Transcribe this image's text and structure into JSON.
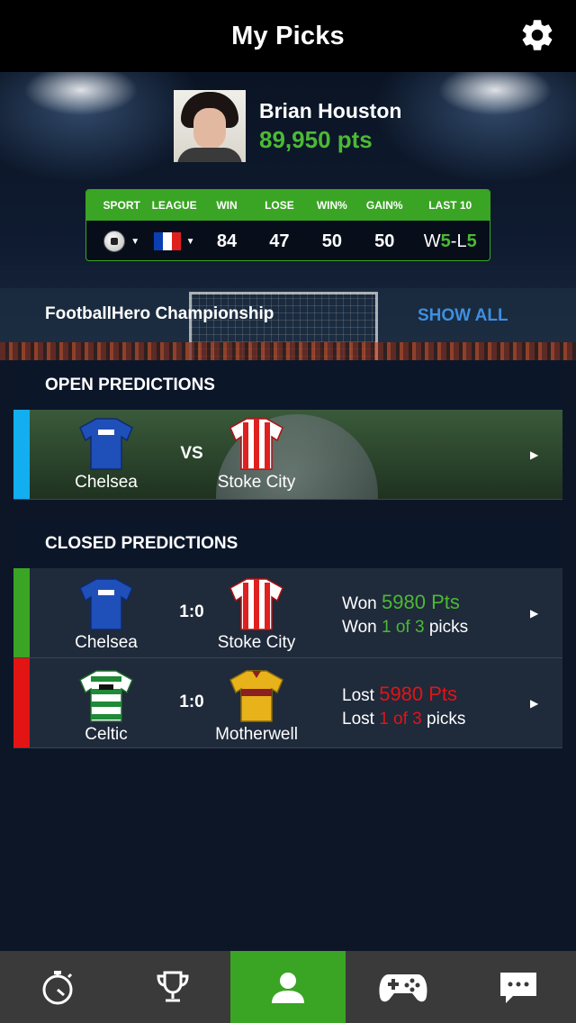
{
  "header": {
    "title": "My Picks",
    "settings_icon": "gear-icon"
  },
  "profile": {
    "name": "Brian Houston",
    "points": "89,950 pts"
  },
  "stats": {
    "headers": [
      "SPORT",
      "LEAGUE",
      "WIN",
      "LOSE",
      "WIN%",
      "GAIN%",
      "LAST 10"
    ],
    "win": "84",
    "lose": "47",
    "win_pct": "50",
    "gain_pct": "50",
    "last10": {
      "w_prefix": "W",
      "w": "5",
      "sep": "-L",
      "l": "5"
    },
    "sport_icon": "soccer-ball-icon",
    "league_icon": "france-flag-icon"
  },
  "championship": {
    "name": "FootballHero Championship",
    "show_all": "SHOW ALL"
  },
  "open_predictions": {
    "title": "OPEN PREDICTIONS",
    "items": [
      {
        "home": "Chelsea",
        "away": "Stoke City",
        "middle": "VS",
        "accent": "#13aef0"
      }
    ]
  },
  "closed_predictions": {
    "title": "CLOSED PREDICTIONS",
    "items": [
      {
        "home": "Chelsea",
        "away": "Stoke City",
        "score": "1:0",
        "accent": "#3aa524",
        "line1_prefix": "Won ",
        "line1_value": "5980 Pts",
        "line2_prefix": "Won ",
        "line2_value": "1 of 3",
        "line2_suffix": " picks",
        "status_color": "#4cb935"
      },
      {
        "home": "Celtic",
        "away": "Motherwell",
        "score": "1:0",
        "accent": "#e31414",
        "line1_prefix": "Lost ",
        "line1_value": "5980 Pts",
        "line2_prefix": "Lost ",
        "line2_value": "1 of 3",
        "line2_suffix": " picks",
        "status_color": "#e31414"
      }
    ]
  },
  "tabbar": {
    "active": "profile",
    "items": [
      "stopwatch-icon",
      "trophy-icon",
      "profile-icon",
      "gamepad-icon",
      "chat-icon"
    ]
  },
  "colors": {
    "accent_green": "#3aa524",
    "link_blue": "#3e8fe0",
    "open_blue": "#13aef0",
    "loss_red": "#e31414"
  }
}
